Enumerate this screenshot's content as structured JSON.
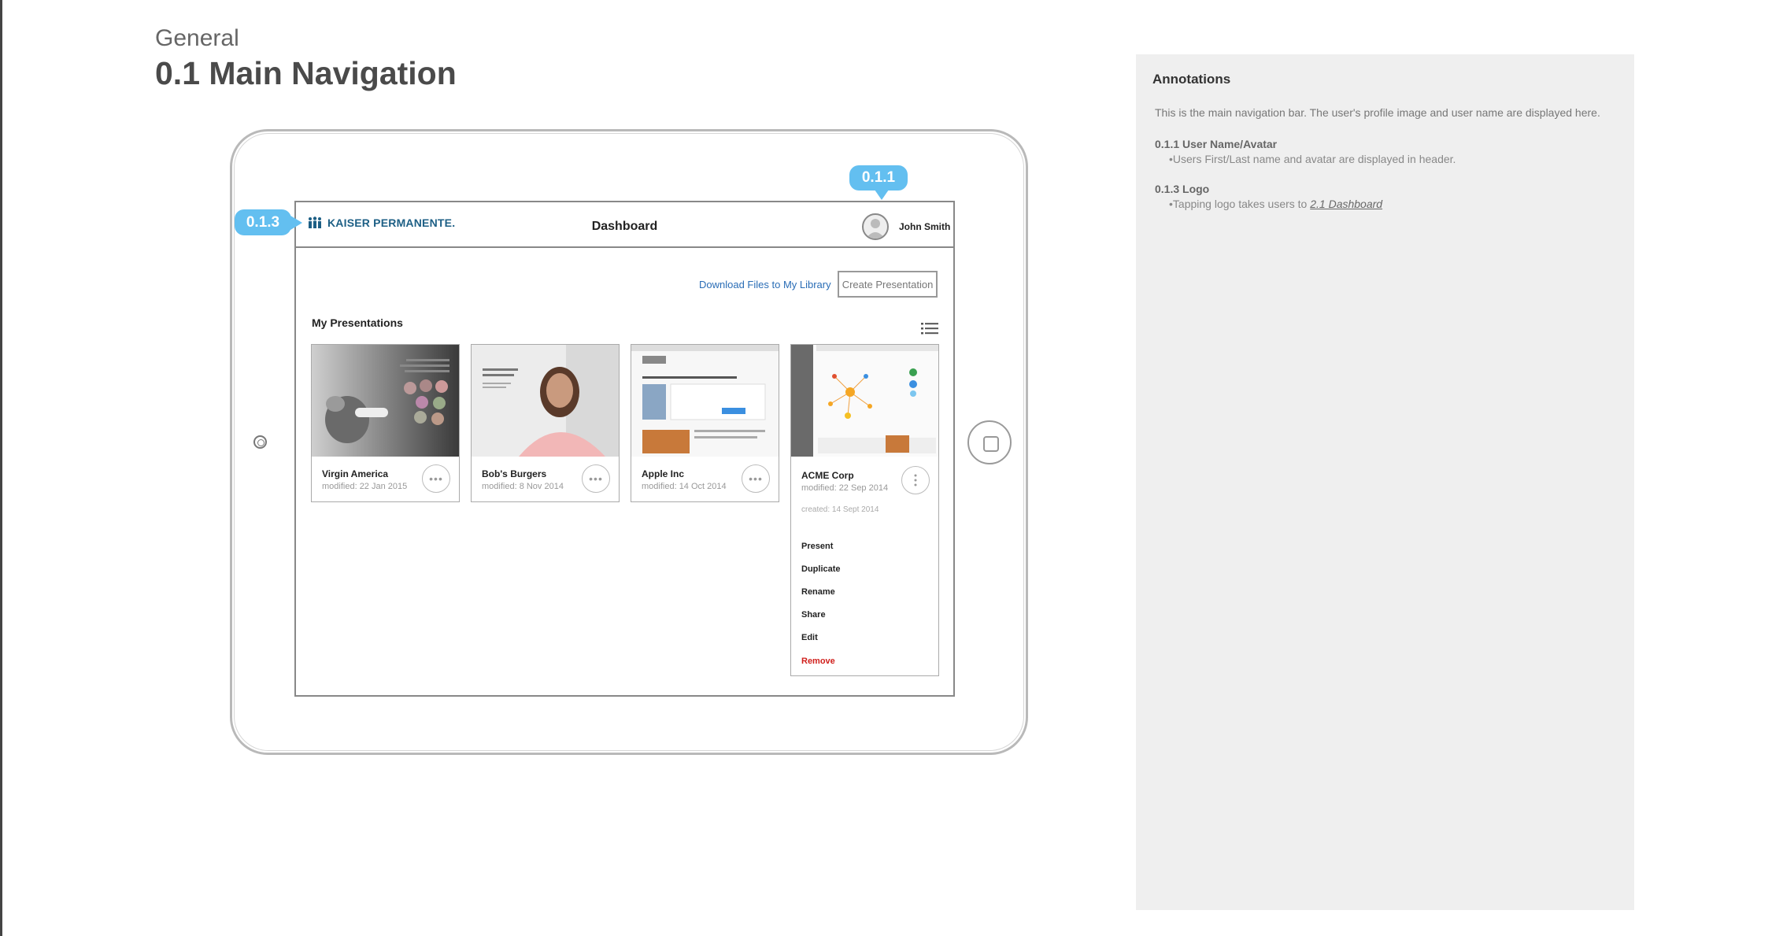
{
  "header": {
    "section": "General",
    "title": "0.1 Main Navigation"
  },
  "app": {
    "logo_text": "KAISER PERMANENTE.",
    "screen_title": "Dashboard",
    "user_name": "John Smith",
    "download_link": "Download Files to My Library",
    "create_button": "Create Presentation",
    "section_title": "My Presentations",
    "more_label": "•••",
    "cards": [
      {
        "name": "Virgin America",
        "modified": "modified: 22 Jan 2015"
      },
      {
        "name": "Bob's Burgers",
        "modified": "modified: 8 Nov 2014"
      },
      {
        "name": "Apple Inc",
        "modified": "modified: 14 Oct 2014"
      },
      {
        "name": "ACME Corp",
        "modified": "modified: 22 Sep 2014",
        "created": "created: 14 Sept 2014",
        "menu": [
          "Present",
          "Duplicate",
          "Rename",
          "Share",
          "Edit",
          "Remove"
        ]
      }
    ]
  },
  "callouts": {
    "logo": "0.1.3",
    "user": "0.1.1"
  },
  "annotations": {
    "title": "Annotations",
    "intro": "This is the main navigation bar.  The user's profile image and user name are displayed here.",
    "items": [
      {
        "heading": "0.1.1 User Name/Avatar",
        "bullet": "•Users First/Last name and avatar are displayed in header."
      },
      {
        "heading": "0.1.3 Logo",
        "bullet_prefix": "•Tapping logo takes users to ",
        "bullet_link": "2.1 Dashboard"
      }
    ]
  },
  "colors": {
    "callout": "#63bff0",
    "link": "#2a6db6",
    "remove": "#d0201c",
    "logo": "#1d5f85"
  }
}
